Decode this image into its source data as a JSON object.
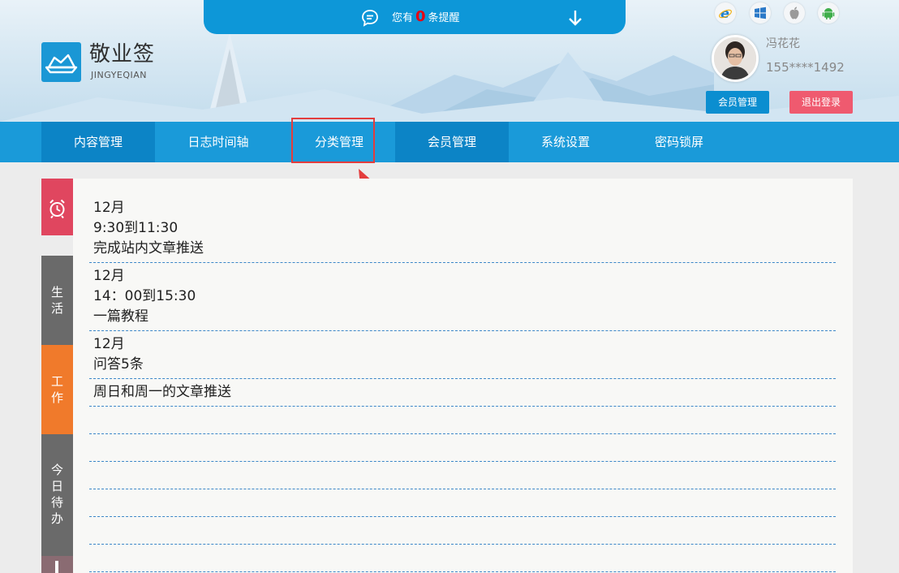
{
  "app": {
    "name": "敬业签",
    "subtitle": "JINGYEQIAN"
  },
  "reminder": {
    "prefix": "您有",
    "count": "0",
    "suffix": "条提醒"
  },
  "user": {
    "name": "冯花花",
    "phone": "155****1492",
    "member_button": "会员管理",
    "logout_button": "退出登录"
  },
  "nav": {
    "items": [
      {
        "label": "内容管理"
      },
      {
        "label": "日志时间轴"
      },
      {
        "label": "分类管理"
      },
      {
        "label": "会员管理"
      },
      {
        "label": "系统设置"
      },
      {
        "label": "密码锁屏"
      }
    ]
  },
  "side_tabs": {
    "life": [
      "生",
      "活"
    ],
    "work": [
      "工",
      "作"
    ],
    "today": [
      "今",
      "日",
      "待",
      "办"
    ]
  },
  "notes": [
    {
      "lines": [
        "12月",
        "9:30到11:30",
        "完成站内文章推送"
      ]
    },
    {
      "lines": [
        "12月",
        "14：00到15:30",
        "一篇教程"
      ]
    },
    {
      "lines": [
        "12月",
        "问答5条"
      ]
    },
    {
      "lines": [
        "周日和周一的文章推送"
      ]
    }
  ],
  "colors": {
    "nav": "#1a9ad9",
    "nav_active": "#0c84c6",
    "tab_alarm": "#e0465f",
    "tab_life": "#6a6a6a",
    "tab_work": "#f07a2b",
    "tab_today": "#6a6a6a",
    "highlight": "#e33d3d"
  }
}
